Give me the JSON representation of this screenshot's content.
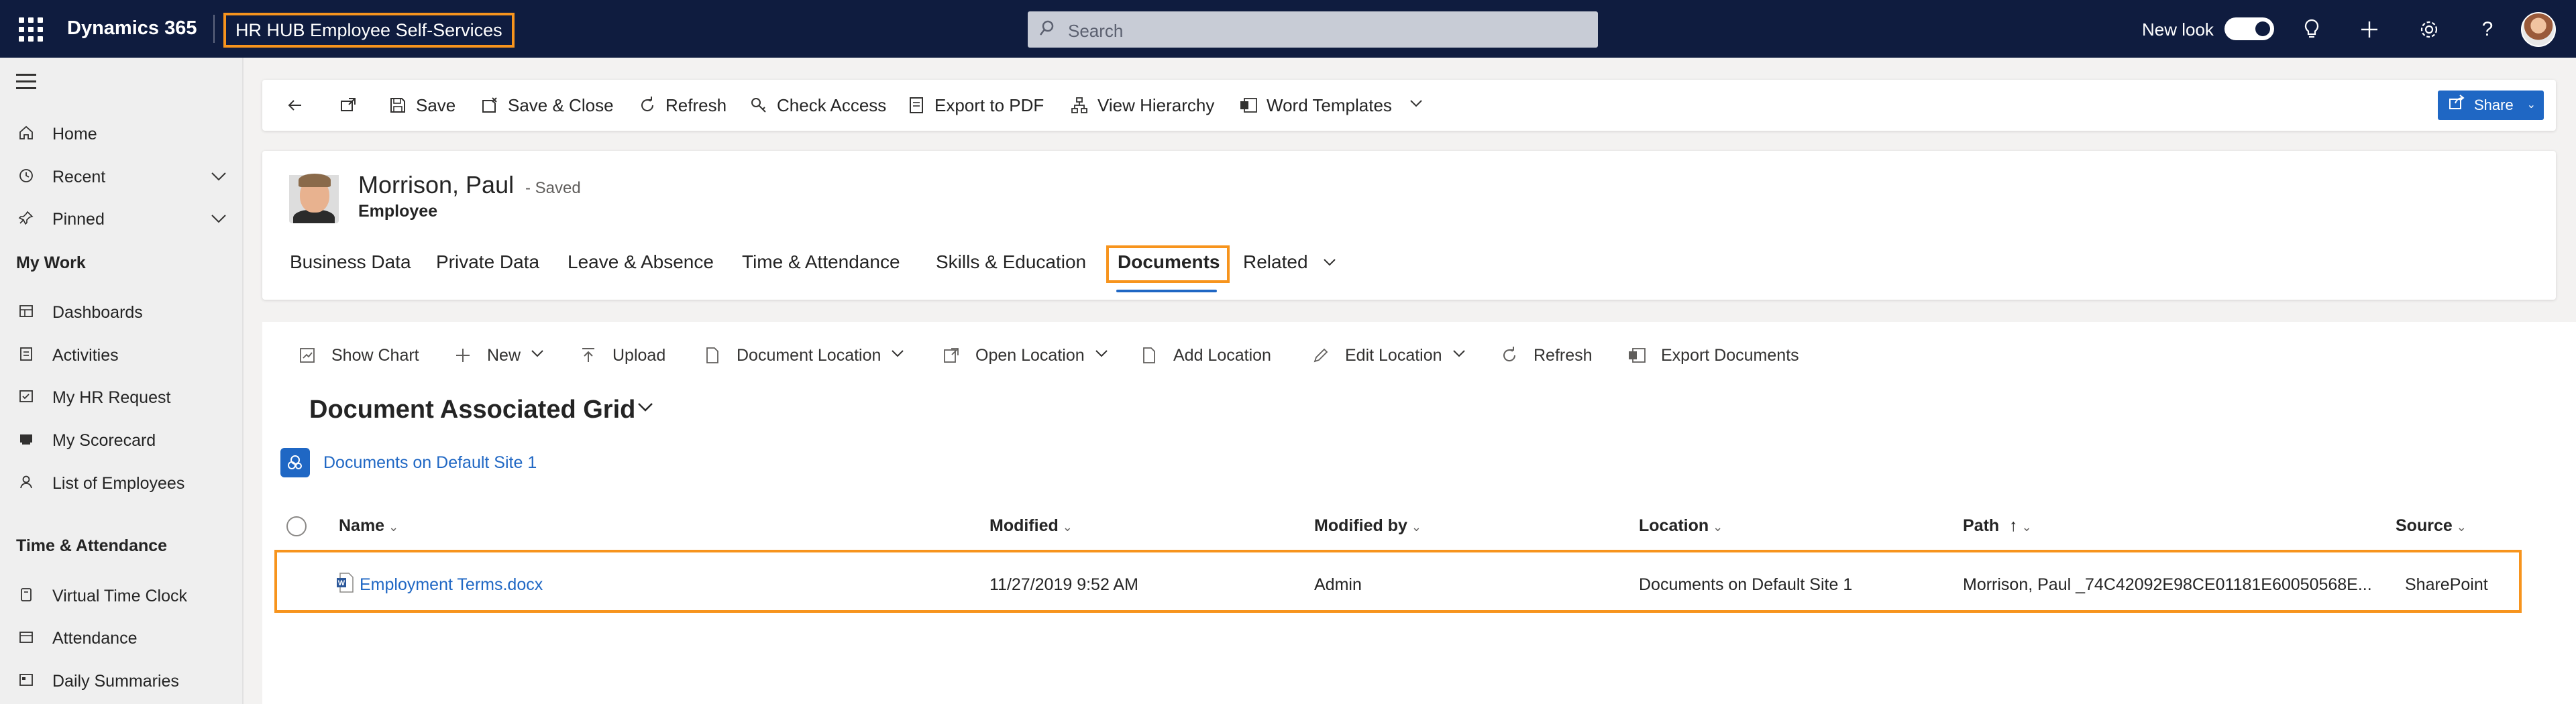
{
  "topbar": {
    "brand": "Dynamics 365",
    "app_title": "HR HUB Employee Self-Services",
    "search_placeholder": "Search",
    "new_look_label": "New look"
  },
  "sidebar": {
    "nav": [
      {
        "label": "Home",
        "icon": "home-icon"
      },
      {
        "label": "Recent",
        "icon": "clock-icon"
      },
      {
        "label": "Pinned",
        "icon": "pin-icon"
      }
    ],
    "sections": [
      {
        "title": "My Work",
        "items": [
          {
            "label": "Dashboards",
            "icon": "dashboard-icon"
          },
          {
            "label": "Activities",
            "icon": "activities-icon"
          },
          {
            "label": "My HR Request",
            "icon": "request-icon"
          },
          {
            "label": "My Scorecard",
            "icon": "scorecard-icon"
          },
          {
            "label": "List of Employees",
            "icon": "person-icon"
          }
        ]
      },
      {
        "title": "Time & Attendance",
        "items": [
          {
            "label": "Virtual Time Clock",
            "icon": "clock-icon"
          },
          {
            "label": "Attendance",
            "icon": "attendance-icon"
          },
          {
            "label": "Daily Summaries",
            "icon": "summary-icon"
          }
        ]
      }
    ]
  },
  "commandbar": {
    "items": [
      "Save",
      "Save & Close",
      "Refresh",
      "Check Access",
      "Export to PDF",
      "View Hierarchy",
      "Word Templates"
    ],
    "share_label": "Share"
  },
  "record": {
    "name": "Morrison, Paul",
    "status": "- Saved",
    "entity": "Employee",
    "tabs": [
      "Business Data",
      "Private Data",
      "Leave & Absence",
      "Time & Attendance",
      "Skills & Education",
      "Documents",
      "Related"
    ],
    "active_tab": "Documents"
  },
  "grid": {
    "toolbar": [
      "Show Chart",
      "New",
      "Upload",
      "Document Location",
      "Open Location",
      "Add Location",
      "Edit Location",
      "Refresh",
      "Export Documents"
    ],
    "title": "Document Associated Grid",
    "site_link": "Documents on Default Site 1",
    "columns": [
      "Name",
      "Modified",
      "Modified by",
      "Location",
      "Path",
      "Source"
    ],
    "sort_indicator": "↑",
    "rows": [
      {
        "name": "Employment Terms.docx",
        "modified": "11/27/2019 9:52 AM",
        "modified_by": "Admin",
        "location": "Documents on Default Site 1",
        "path": "Morrison, Paul _74C42092E98CE01181E60050568E...",
        "source": "SharePoint"
      }
    ]
  },
  "colors": {
    "topbar_bg": "#0f1c3f",
    "highlight": "#f7941d",
    "accent": "#1f67c4"
  }
}
